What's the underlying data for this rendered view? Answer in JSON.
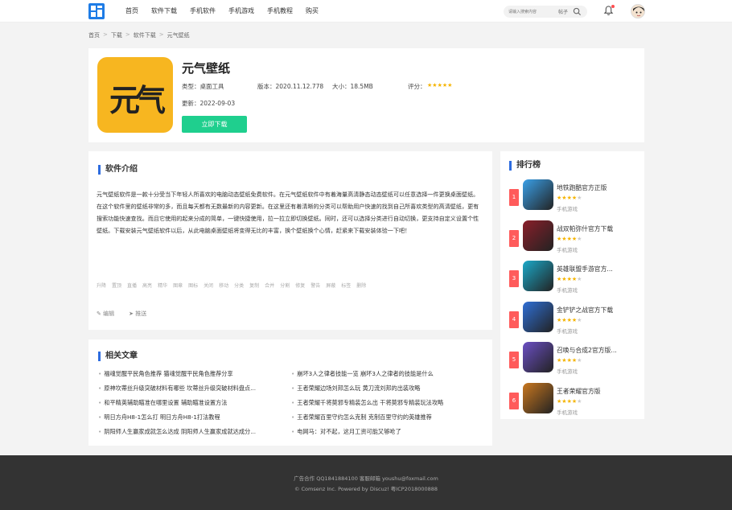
{
  "header": {
    "nav": [
      "首页",
      "软件下载",
      "手机软件",
      "手机游戏",
      "手机教程",
      "购买"
    ],
    "search_placeholder": "请输入搜索内容",
    "search_type": "帖子"
  },
  "breadcrumb": [
    "首页",
    "下载",
    "软件下载",
    "元气壁纸"
  ],
  "app": {
    "icon_text": "元气",
    "title": "元气壁纸",
    "type": "类型：桌面工具",
    "version": "版本：2020.11.12.778",
    "size": "大小：18.5MB",
    "rating_label": "评分：",
    "rating_stars": 5,
    "updated": "更新：2022-09-03",
    "download_label": "立即下载"
  },
  "intro": {
    "title": "软件介绍",
    "text": "元气壁纸软件是一款十分受当下年轻人所喜欢的电脑动态壁纸免费软件。在元气壁纸软件中有着海量高清静态动态壁纸可以任意选择一件更换桌面壁纸。在这个软件里的壁纸非常的多，而且每天都有无数最新的内容更新。在这里还有着清晰的分类可以帮助用户快速的找到自己所喜欢类型的高清壁纸，更有搜索功能快速查找。而且它使用的起来分成的简单，一键快捷使用，拉一拉立即切换壁纸。同时，还可以选择分类进行自动切换，更支持自定义设置个性壁纸。下载安装元气壁纸软件以后，从此电脑桌面壁纸将变得无比的丰富，换个壁纸换个心情，赶紧来下载安装体验一下吧！",
    "toolbar": [
      "升降",
      "置顶",
      "直播",
      "高亮",
      "精华",
      "图章",
      "图标",
      "关闭",
      "移动",
      "分类",
      "复制",
      "合并",
      "分割",
      "修复",
      "警告",
      "屏蔽",
      "标签",
      "删除"
    ],
    "edit_label": "编辑",
    "push_label": "推送"
  },
  "related": {
    "title": "相关文章",
    "left": [
      "福魂觉醒平民角色推荐 猫魂觉醒平民角色推荐分享",
      "原神坎蒂丝升级突破材料有哪些 坎蒂丝升级突破材料盘点...",
      "和平精英辅助瞄准在哪里设置 辅助瞄准设置方法",
      "明日方舟H8-1怎么打 明日方舟H8-1打法教程",
      "阴阳师人生赢家成就怎么达成 阴阳师人生赢家成就达成分..."
    ],
    "right": [
      "崩坏3人之律者技能一览 崩坏3人之律者的技能是什么",
      "王者荣耀边场刘邦怎么玩 黄刀流刘邦的出装攻略",
      "王者荣耀千将莫邪专精装怎么出 干将莫邪专精装玩法攻略",
      "王者荣耀百里守约怎么克制 克制百里守约的英雄推荐",
      "电网马：对不起，这月工资可能又够呛了"
    ]
  },
  "ranking": {
    "title": "排行榜",
    "items": [
      {
        "rank": "1",
        "name": "地铁跑酷官方正版",
        "stars": 4,
        "category": "手机游戏",
        "color": "#3aa0e8"
      },
      {
        "rank": "2",
        "name": "战双帕弥什官方下载",
        "stars": 4,
        "category": "手机游戏",
        "color": "#8a1f2a"
      },
      {
        "rank": "3",
        "name": "英雄联盟手游官方...",
        "stars": 4,
        "category": "手机游戏",
        "color": "#1ba9c9"
      },
      {
        "rank": "4",
        "name": "金铲铲之战官方下载",
        "stars": 4,
        "category": "手机游戏",
        "color": "#2f6fd6"
      },
      {
        "rank": "5",
        "name": "召唤与合成2官方版...",
        "stars": 4,
        "category": "手机游戏",
        "color": "#6b4fc4"
      },
      {
        "rank": "6",
        "name": "王者荣耀官方版",
        "stars": 4,
        "category": "手机游戏",
        "color": "#c9771f"
      }
    ]
  },
  "footer": {
    "line1": "广告合作 QQ1841884100 客服邮箱 youshu@foxmail.com",
    "line2": "© Comsenz Inc. Powered by Discuz! 粤ICP2018000888"
  },
  "accent_color": "#2d6cdf",
  "download_color": "#1fcf8e"
}
